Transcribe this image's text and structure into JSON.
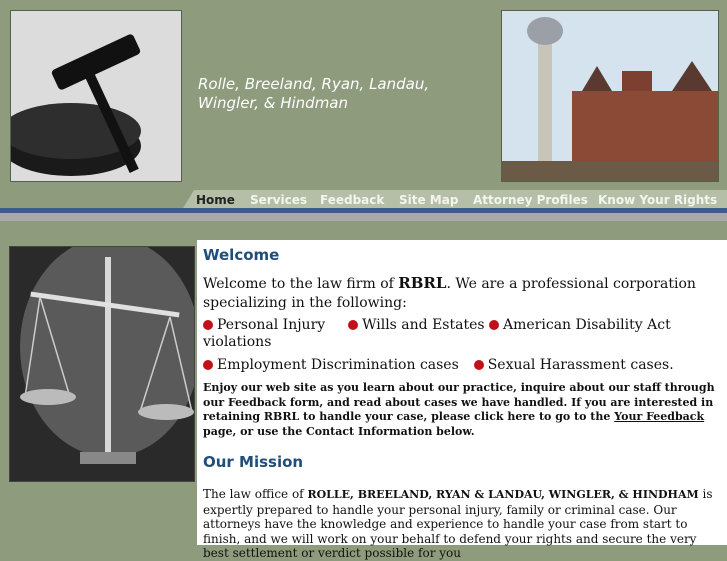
{
  "header": {
    "firm_name_line1": "Rolle, Breeland, Ryan, Landau,",
    "firm_name_line2": "Wingler, & Hindman"
  },
  "nav": {
    "items": [
      "Home",
      "Services",
      "Feedback",
      "Site Map",
      "Attorney Profiles",
      "Know Your Rights"
    ],
    "active": "Home"
  },
  "welcome": {
    "heading": "Welcome",
    "intro_prefix": "Welcome to the law firm of",
    "intro_firm": "RBRL",
    "intro_suffix": ".   We are a professional corporation specializing in the following:",
    "practice_areas": [
      "Personal Injury",
      "Wills and Estates",
      "American Disability Act violations",
      "Employment Discrimination cases",
      "Sexual Harassment cases."
    ],
    "enjoy_text_prefix": "Enjoy our web site as you learn about our practice, inquire about our staff through our Feedback form, and read about cases we have handled.  If you are interested in retaining RBRL to handle your case, please click here to go to the",
    "feedback_link": "Your Feedback",
    "enjoy_text_suffix": "page, or use the Contact Information below."
  },
  "mission": {
    "heading": "Our Mission",
    "text_prefix": "The law office of",
    "firm_caps": "ROLLE, BREELAND, RYAN & LANDAU, WINGLER, & HINDHAM",
    "text_suffix": "is expertly prepared to handle your personal injury, family or criminal case.  Our attorneys have the knowledge and experience to handle your case from start to finish, and we will work on your behalf to defend your rights and secure the very best settlement or verdict possible for you"
  },
  "colors": {
    "olive_background": "#8e9b7c",
    "nav_tab": "#b5bea6",
    "rule_blue": "#3d5d87",
    "heading_blue": "#1f4e7a",
    "bullet_red": "#c0101a"
  }
}
